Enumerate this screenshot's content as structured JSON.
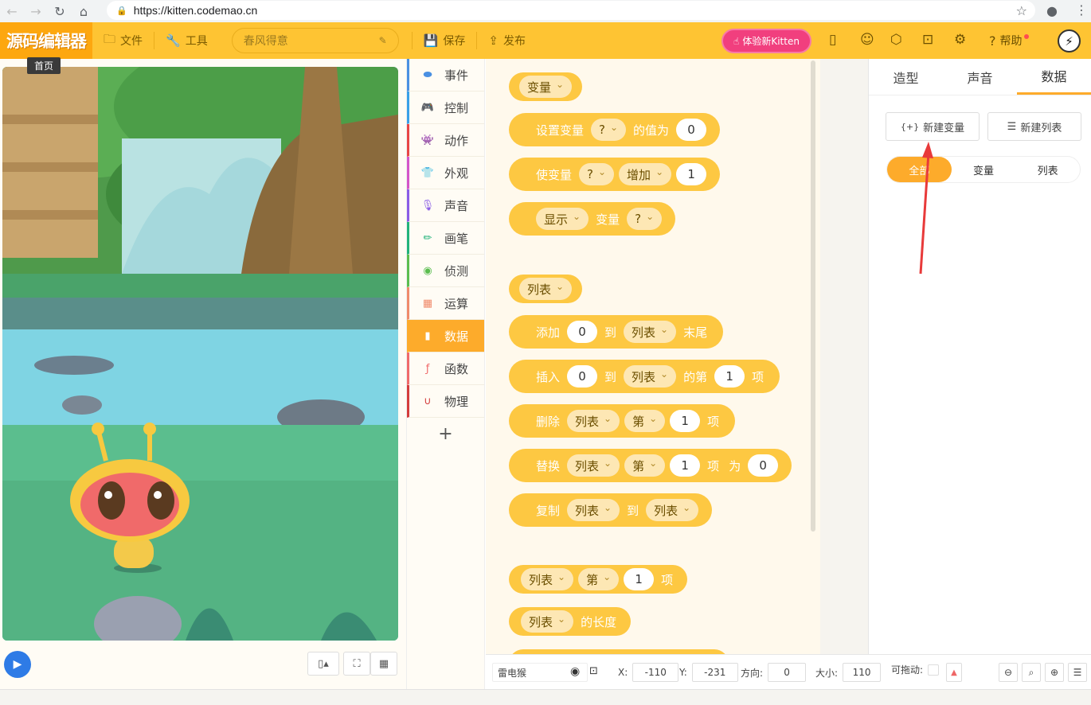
{
  "browser": {
    "url": "https://kitten.codemao.cn"
  },
  "header": {
    "logo": "源码编辑器",
    "file_label": "文件",
    "tools_label": "工具",
    "project_title": "春风得意",
    "save_label": "保存",
    "publish_label": "发布",
    "try_kitten_label": "体验新Kitten",
    "help_label": "帮助"
  },
  "tooltip": "首页",
  "categories": [
    {
      "label": "事件",
      "icon": "toggle-icon",
      "color": "#4a90e2"
    },
    {
      "label": "控制",
      "icon": "gamepad-icon",
      "color": "#3aa0e8"
    },
    {
      "label": "动作",
      "icon": "ghost-icon",
      "color": "#e84545"
    },
    {
      "label": "外观",
      "icon": "shirt-icon",
      "color": "#d455c9"
    },
    {
      "label": "声音",
      "icon": "mic-icon",
      "color": "#8a5ce6"
    },
    {
      "label": "画笔",
      "icon": "pen-icon",
      "color": "#22b37a"
    },
    {
      "label": "侦测",
      "icon": "radar-icon",
      "color": "#5bbd4f"
    },
    {
      "label": "运算",
      "icon": "calc-icon",
      "color": "#f08a6a"
    },
    {
      "label": "数据",
      "icon": "bar-chart-icon",
      "color": "#ffffff"
    },
    {
      "label": "函数",
      "icon": "function-icon",
      "color": "#f06a6a"
    },
    {
      "label": "物理",
      "icon": "magnet-icon",
      "color": "#d43c3c"
    }
  ],
  "palette": {
    "var_hat": "变量",
    "set_var": {
      "a": "设置变量",
      "dd": "?",
      "b": "的值为",
      "n": "0"
    },
    "change_var": {
      "a": "使变量",
      "dd": "?",
      "op": "增加",
      "n": "1"
    },
    "show_var": {
      "dd": "显示",
      "a": "变量",
      "v": "?"
    },
    "list_hat": "列表",
    "add_list": {
      "a": "添加",
      "n": "0",
      "b": "到",
      "dd": "列表",
      "c": "末尾"
    },
    "insert_list": {
      "a": "插入",
      "n": "0",
      "b": "到",
      "dd": "列表",
      "c": "的第",
      "n2": "1",
      "d": "项"
    },
    "delete_list": {
      "a": "删除",
      "dd": "列表",
      "dd2": "第",
      "n": "1",
      "b": "项"
    },
    "replace_list": {
      "a": "替换",
      "dd": "列表",
      "dd2": "第",
      "n": "1",
      "b": "项",
      "c": "为",
      "n2": "0"
    },
    "copy_list": {
      "a": "复制",
      "dd": "列表",
      "b": "到",
      "dd2": "列表"
    },
    "item_list": {
      "dd": "列表",
      "dd2": "第",
      "n": "1",
      "b": "项"
    },
    "length_list": {
      "dd": "列表",
      "b": "的长度"
    }
  },
  "right_panel": {
    "tabs": [
      "造型",
      "声音",
      "数据"
    ],
    "new_var_label": "新建变量",
    "new_list_label": "新建列表",
    "filter": [
      "全部",
      "变量",
      "列表"
    ]
  },
  "sprite_info": {
    "name": "雷电猴",
    "x_label": "X:",
    "x": "-110",
    "y_label": "Y:",
    "y": "-231",
    "dir_label": "方向:",
    "dir": "0",
    "size_label": "大小:",
    "size": "110",
    "drag_label": "可拖动:"
  },
  "colors": {
    "header": "#fec433",
    "accent": "#fdab2b",
    "block": "#fdc842",
    "play": "#2e7be6"
  }
}
